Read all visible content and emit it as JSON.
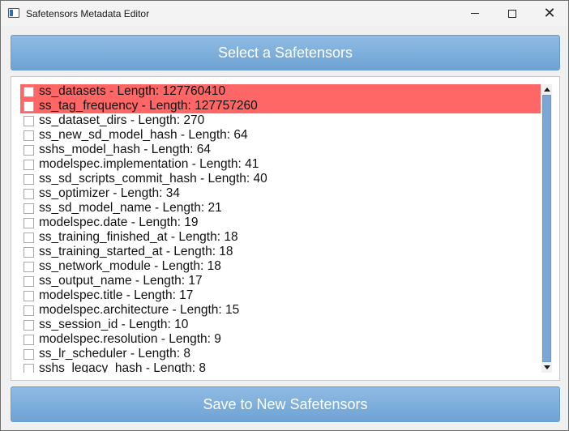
{
  "window": {
    "title": "Safetensors Metadata Editor",
    "minimize_icon": "minimize-icon",
    "maximize_icon": "maximize-icon",
    "close_icon": "close-icon",
    "close_glyph": "✕"
  },
  "buttons": {
    "select_label": "Select a Safetensors",
    "save_label": "Save to New Safetensors"
  },
  "colors": {
    "selected_row": "#ff6666",
    "button_accent": "#7aadd9"
  },
  "list": {
    "items": [
      {
        "label": "ss_datasets - Length: 127760410",
        "selected": true
      },
      {
        "label": "ss_tag_frequency - Length: 127757260",
        "selected": true
      },
      {
        "label": "ss_dataset_dirs - Length: 270",
        "selected": false
      },
      {
        "label": "ss_new_sd_model_hash - Length: 64",
        "selected": false
      },
      {
        "label": "sshs_model_hash - Length: 64",
        "selected": false
      },
      {
        "label": "modelspec.implementation - Length: 41",
        "selected": false
      },
      {
        "label": "ss_sd_scripts_commit_hash - Length: 40",
        "selected": false
      },
      {
        "label": "ss_optimizer - Length: 34",
        "selected": false
      },
      {
        "label": "ss_sd_model_name - Length: 21",
        "selected": false
      },
      {
        "label": "modelspec.date - Length: 19",
        "selected": false
      },
      {
        "label": "ss_training_finished_at - Length: 18",
        "selected": false
      },
      {
        "label": "ss_training_started_at - Length: 18",
        "selected": false
      },
      {
        "label": "ss_network_module - Length: 18",
        "selected": false
      },
      {
        "label": "ss_output_name - Length: 17",
        "selected": false
      },
      {
        "label": "modelspec.title - Length: 17",
        "selected": false
      },
      {
        "label": "modelspec.architecture - Length: 15",
        "selected": false
      },
      {
        "label": "ss_session_id - Length: 10",
        "selected": false
      },
      {
        "label": "modelspec.resolution - Length: 9",
        "selected": false
      },
      {
        "label": "ss_lr_scheduler - Length: 8",
        "selected": false
      },
      {
        "label": "sshs_legacy_hash - Length: 8",
        "selected": false
      }
    ]
  }
}
